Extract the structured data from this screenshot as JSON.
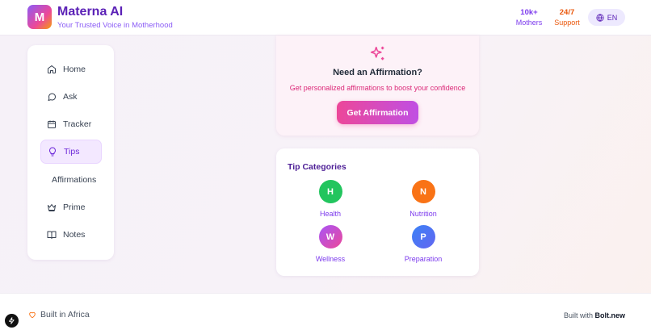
{
  "header": {
    "logo_letter": "M",
    "title": "Materna AI",
    "tagline": "Your Trusted Voice in Motherhood",
    "stats": [
      {
        "value": "10k+",
        "label": "Mothers",
        "color": "#7c3aed"
      },
      {
        "value": "24/7",
        "label": "Support",
        "color": "#ea580c"
      }
    ],
    "language": {
      "icon": "globe-icon",
      "label": "EN"
    }
  },
  "sidebar": {
    "items": [
      {
        "label": "Home",
        "icon": "home-icon",
        "active": false
      },
      {
        "label": "Ask",
        "icon": "chat-bubble-icon",
        "active": false
      },
      {
        "label": "Tracker",
        "icon": "calendar-icon",
        "active": false
      },
      {
        "label": "Tips",
        "icon": "lightbulb-icon",
        "active": true
      },
      {
        "label": "Affirmations",
        "icon": "",
        "active": false
      },
      {
        "label": "Prime",
        "icon": "crown-icon",
        "active": false
      },
      {
        "label": "Notes",
        "icon": "book-icon",
        "active": false
      }
    ]
  },
  "affirmation": {
    "icon": "sparkles-icon",
    "title": "Need an Affirmation?",
    "description": "Get personalized affirmations to boost your confidence",
    "button_label": "Get Affirmation"
  },
  "tip_categories": {
    "title": "Tip Categories",
    "items": [
      {
        "letter": "H",
        "label": "Health",
        "color": "#22c55e"
      },
      {
        "letter": "N",
        "label": "Nutrition",
        "color": "#f97316"
      },
      {
        "letter": "W",
        "label": "Wellness",
        "color": "#c04fd8"
      },
      {
        "letter": "P",
        "label": "Preparation",
        "color": "#3b82f6"
      }
    ]
  },
  "footer": {
    "left_label": "Built in Africa",
    "right_prefix": "Built with",
    "right_brand": "Bolt.new"
  },
  "colors": {
    "brand_purple": "#5b21b6",
    "accent_pink": "#ec4899",
    "support_orange": "#ea580c"
  }
}
